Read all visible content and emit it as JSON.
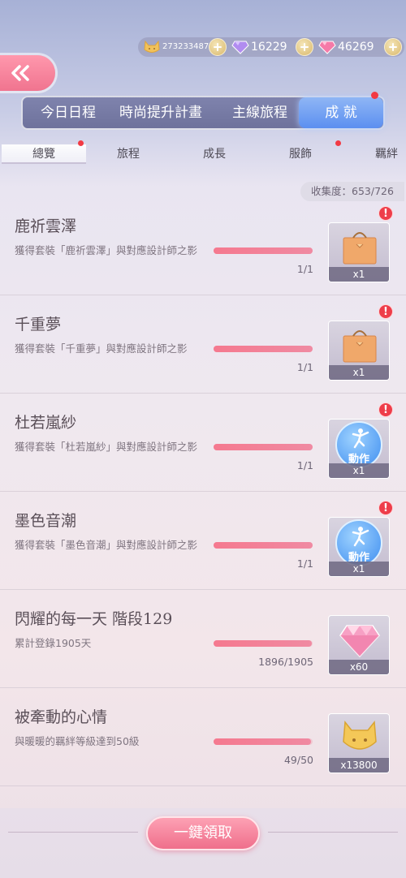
{
  "currency": {
    "cat_coins": "273233487",
    "diamonds": "16229",
    "pink_diamonds": "46269"
  },
  "main_tabs": [
    {
      "label": "今日日程"
    },
    {
      "label": "時尚提升計畫"
    },
    {
      "label": "主線旅程"
    },
    {
      "label": "成 就",
      "active": true
    }
  ],
  "sub_tabs": [
    {
      "label": "總覽",
      "active": true
    },
    {
      "label": "旅程"
    },
    {
      "label": "成長"
    },
    {
      "label": "服飾"
    },
    {
      "label": "羈絆"
    }
  ],
  "collection": {
    "text": "收集度：653/726"
  },
  "achievements": [
    {
      "title": "鹿祈雲澤",
      "desc": "獲得套裝「鹿祈雲澤」與對應設計師之影",
      "progress": "1/1",
      "fraction": 1.0,
      "reward_qty": "x1",
      "reward_icon": "gift-bag-icon"
    },
    {
      "title": "千重夢",
      "desc": "獲得套裝「千重夢」與對應設計師之影",
      "progress": "1/1",
      "fraction": 1.0,
      "reward_qty": "x1",
      "reward_icon": "gift-bag-icon"
    },
    {
      "title": "杜若嵐紗",
      "desc": "獲得套裝「杜若嵐紗」與對應設計師之影",
      "progress": "1/1",
      "fraction": 1.0,
      "reward_qty": "x1",
      "reward_icon": "action-icon",
      "reward_label": "動作"
    },
    {
      "title": "墨色音潮",
      "desc": "獲得套裝「墨色音潮」與對應設計師之影",
      "progress": "1/1",
      "fraction": 1.0,
      "reward_qty": "x1",
      "reward_icon": "action-icon",
      "reward_label": "動作"
    },
    {
      "title": "閃耀的每一天 階段129",
      "desc": "累計登錄1905天",
      "progress": "1896/1905",
      "fraction": 0.995,
      "reward_qty": "x60",
      "reward_icon": "diamond-icon"
    },
    {
      "title": "被牽動的心情",
      "desc": "與暖暖的羈絆等級達到50級",
      "progress": "49/50",
      "fraction": 0.98,
      "reward_qty": "x13800",
      "reward_icon": "cat-coin-icon"
    }
  ],
  "claim_button": {
    "label": "一鍵領取"
  },
  "colors": {
    "accent_pink": "#f0748f",
    "alert_red": "#ee3d4a",
    "tab_active_blue": "#5c8ff0"
  }
}
